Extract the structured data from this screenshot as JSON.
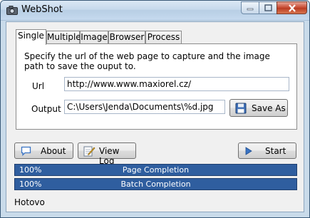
{
  "window": {
    "title": "WebShot"
  },
  "tabs": [
    {
      "label": "Single",
      "active": true
    },
    {
      "label": "Multiple",
      "active": false
    },
    {
      "label": "Image",
      "active": false
    },
    {
      "label": "Browser",
      "active": false
    },
    {
      "label": "Process",
      "active": false
    }
  ],
  "single": {
    "description": "Specify the url of the web page to capture and the image path to save the ouput to.",
    "url_label": "Url",
    "url_value": "http://www.www.maxiorel.cz/",
    "output_label": "Output",
    "output_value": "C:\\Users\\Jenda\\Documents\\%d.jpg",
    "save_as_label": "Save As"
  },
  "buttons": {
    "about": "About",
    "view_log": "View Log",
    "start": "Start"
  },
  "progress": {
    "page": {
      "percent_text": "100%",
      "caption": "Page Completion",
      "value": 100
    },
    "batch": {
      "percent_text": "100%",
      "caption": "Batch Completion",
      "value": 100
    }
  },
  "status": "Hotovo",
  "colors": {
    "progress_fill": "#2f5e9f",
    "titlebar": "#c6d9ec",
    "close_button": "#c6472f"
  }
}
